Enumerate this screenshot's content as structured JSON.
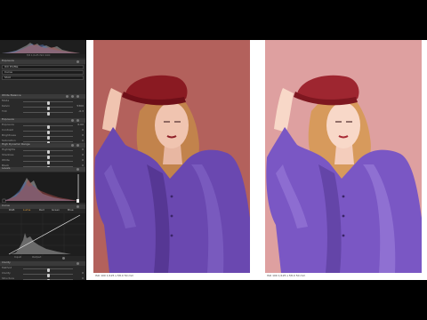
{
  "panel": {
    "histogram_readout": "f/8  1/125  ISO 100",
    "sections": {
      "exposure": "Exposure",
      "color_profile": "ICC Profile",
      "white_balance": "White Balance",
      "white_balance_mode": "Shot",
      "exposure2": "Exposure",
      "hdr": "High Dynamic Range",
      "levels": "Levels",
      "curve": "Curve",
      "clarity": "Clarity",
      "clarity_method": "Natural"
    },
    "wb_rows": [
      {
        "label": "Mode",
        "value": ""
      },
      {
        "label": "Kelvin",
        "value": "5300"
      },
      {
        "label": "Tint",
        "value": "-0.3"
      }
    ],
    "exposure_rows": [
      {
        "label": "Exposure",
        "value": "0.00"
      },
      {
        "label": "Contrast",
        "value": "0"
      },
      {
        "label": "Brightness",
        "value": "0"
      },
      {
        "label": "Saturation",
        "value": "0"
      }
    ],
    "hdr_rows": [
      {
        "label": "Highlights",
        "value": "0"
      },
      {
        "label": "Shadows",
        "value": "0"
      },
      {
        "label": "White",
        "value": "0"
      },
      {
        "label": "Black",
        "value": "0"
      }
    ],
    "curve_tabs": [
      "RGB",
      "Luma",
      "Red",
      "Green",
      "Blue"
    ],
    "curve_io": [
      "Input",
      "Output"
    ],
    "clarity_rows": [
      {
        "label": "Method",
        "value": ""
      },
      {
        "label": "Clarity",
        "value": "0"
      },
      {
        "label": "Structure",
        "value": "0"
      }
    ]
  },
  "viewer": {
    "before": {
      "left": "ISO 100  1/125 s  f/8.0  50 mm",
      "center": "",
      "right": ""
    },
    "after": {
      "left": "ISO 100  1/125 s  f/8.0  50 mm",
      "center": "",
      "right": ""
    }
  },
  "colors": {
    "background_before": "#b3615c",
    "background_after": "#dea0a0",
    "blouse": "#6a48b0",
    "hat": "#8a1a22",
    "hair": "#c2834c"
  }
}
